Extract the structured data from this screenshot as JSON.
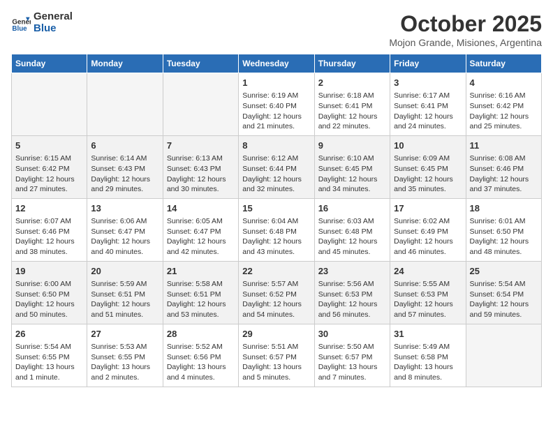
{
  "header": {
    "logo_line1": "General",
    "logo_line2": "Blue",
    "month": "October 2025",
    "location": "Mojon Grande, Misiones, Argentina"
  },
  "days_of_week": [
    "Sunday",
    "Monday",
    "Tuesday",
    "Wednesday",
    "Thursday",
    "Friday",
    "Saturday"
  ],
  "weeks": [
    [
      {
        "day": "",
        "info": ""
      },
      {
        "day": "",
        "info": ""
      },
      {
        "day": "",
        "info": ""
      },
      {
        "day": "1",
        "info": "Sunrise: 6:19 AM\nSunset: 6:40 PM\nDaylight: 12 hours and 21 minutes."
      },
      {
        "day": "2",
        "info": "Sunrise: 6:18 AM\nSunset: 6:41 PM\nDaylight: 12 hours and 22 minutes."
      },
      {
        "day": "3",
        "info": "Sunrise: 6:17 AM\nSunset: 6:41 PM\nDaylight: 12 hours and 24 minutes."
      },
      {
        "day": "4",
        "info": "Sunrise: 6:16 AM\nSunset: 6:42 PM\nDaylight: 12 hours and 25 minutes."
      }
    ],
    [
      {
        "day": "5",
        "info": "Sunrise: 6:15 AM\nSunset: 6:42 PM\nDaylight: 12 hours and 27 minutes."
      },
      {
        "day": "6",
        "info": "Sunrise: 6:14 AM\nSunset: 6:43 PM\nDaylight: 12 hours and 29 minutes."
      },
      {
        "day": "7",
        "info": "Sunrise: 6:13 AM\nSunset: 6:43 PM\nDaylight: 12 hours and 30 minutes."
      },
      {
        "day": "8",
        "info": "Sunrise: 6:12 AM\nSunset: 6:44 PM\nDaylight: 12 hours and 32 minutes."
      },
      {
        "day": "9",
        "info": "Sunrise: 6:10 AM\nSunset: 6:45 PM\nDaylight: 12 hours and 34 minutes."
      },
      {
        "day": "10",
        "info": "Sunrise: 6:09 AM\nSunset: 6:45 PM\nDaylight: 12 hours and 35 minutes."
      },
      {
        "day": "11",
        "info": "Sunrise: 6:08 AM\nSunset: 6:46 PM\nDaylight: 12 hours and 37 minutes."
      }
    ],
    [
      {
        "day": "12",
        "info": "Sunrise: 6:07 AM\nSunset: 6:46 PM\nDaylight: 12 hours and 38 minutes."
      },
      {
        "day": "13",
        "info": "Sunrise: 6:06 AM\nSunset: 6:47 PM\nDaylight: 12 hours and 40 minutes."
      },
      {
        "day": "14",
        "info": "Sunrise: 6:05 AM\nSunset: 6:47 PM\nDaylight: 12 hours and 42 minutes."
      },
      {
        "day": "15",
        "info": "Sunrise: 6:04 AM\nSunset: 6:48 PM\nDaylight: 12 hours and 43 minutes."
      },
      {
        "day": "16",
        "info": "Sunrise: 6:03 AM\nSunset: 6:48 PM\nDaylight: 12 hours and 45 minutes."
      },
      {
        "day": "17",
        "info": "Sunrise: 6:02 AM\nSunset: 6:49 PM\nDaylight: 12 hours and 46 minutes."
      },
      {
        "day": "18",
        "info": "Sunrise: 6:01 AM\nSunset: 6:50 PM\nDaylight: 12 hours and 48 minutes."
      }
    ],
    [
      {
        "day": "19",
        "info": "Sunrise: 6:00 AM\nSunset: 6:50 PM\nDaylight: 12 hours and 50 minutes."
      },
      {
        "day": "20",
        "info": "Sunrise: 5:59 AM\nSunset: 6:51 PM\nDaylight: 12 hours and 51 minutes."
      },
      {
        "day": "21",
        "info": "Sunrise: 5:58 AM\nSunset: 6:51 PM\nDaylight: 12 hours and 53 minutes."
      },
      {
        "day": "22",
        "info": "Sunrise: 5:57 AM\nSunset: 6:52 PM\nDaylight: 12 hours and 54 minutes."
      },
      {
        "day": "23",
        "info": "Sunrise: 5:56 AM\nSunset: 6:53 PM\nDaylight: 12 hours and 56 minutes."
      },
      {
        "day": "24",
        "info": "Sunrise: 5:55 AM\nSunset: 6:53 PM\nDaylight: 12 hours and 57 minutes."
      },
      {
        "day": "25",
        "info": "Sunrise: 5:54 AM\nSunset: 6:54 PM\nDaylight: 12 hours and 59 minutes."
      }
    ],
    [
      {
        "day": "26",
        "info": "Sunrise: 5:54 AM\nSunset: 6:55 PM\nDaylight: 13 hours and 1 minute."
      },
      {
        "day": "27",
        "info": "Sunrise: 5:53 AM\nSunset: 6:55 PM\nDaylight: 13 hours and 2 minutes."
      },
      {
        "day": "28",
        "info": "Sunrise: 5:52 AM\nSunset: 6:56 PM\nDaylight: 13 hours and 4 minutes."
      },
      {
        "day": "29",
        "info": "Sunrise: 5:51 AM\nSunset: 6:57 PM\nDaylight: 13 hours and 5 minutes."
      },
      {
        "day": "30",
        "info": "Sunrise: 5:50 AM\nSunset: 6:57 PM\nDaylight: 13 hours and 7 minutes."
      },
      {
        "day": "31",
        "info": "Sunrise: 5:49 AM\nSunset: 6:58 PM\nDaylight: 13 hours and 8 minutes."
      },
      {
        "day": "",
        "info": ""
      }
    ]
  ]
}
